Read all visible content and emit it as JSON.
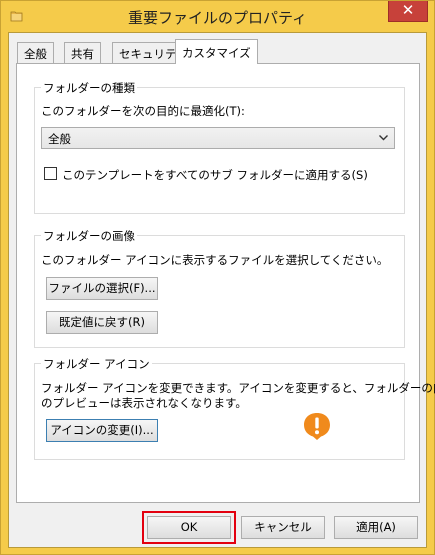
{
  "window": {
    "title": "重要ファイルのプロパティ",
    "close_glyph": "✕"
  },
  "tabs": [
    {
      "label": "全般"
    },
    {
      "label": "共有"
    },
    {
      "label": "セキュリティ"
    },
    {
      "label": "カスタマイズ"
    }
  ],
  "folder_type": {
    "title": "フォルダーの種類",
    "optimize_label": "このフォルダーを次の目的に最適化(T):",
    "selected_option": "全般",
    "apply_subfolders_label": "このテンプレートをすべてのサブ フォルダーに適用する(S)",
    "apply_subfolders_checked": false
  },
  "folder_picture": {
    "title": "フォルダーの画像",
    "description": "このフォルダー アイコンに表示するファイルを選択してください。",
    "choose_file_button": "ファイルの選択(F)...",
    "restore_default_button": "既定値に戻す(R)"
  },
  "folder_icon": {
    "title": "フォルダー アイコン",
    "description_line1": "フォルダー アイコンを変更できます。アイコンを変更すると、フォルダーの内容",
    "description_line2": "のプレビューは表示されなくなります。",
    "change_icon_button": "アイコンの変更(I)...",
    "icon_name": "exclamation-balloon-icon",
    "icon_color": "#f08a1c"
  },
  "footer": {
    "ok_button": "OK",
    "cancel_button": "キャンセル",
    "apply_button": "適用(A)",
    "highlight_color": "#e3000f"
  }
}
